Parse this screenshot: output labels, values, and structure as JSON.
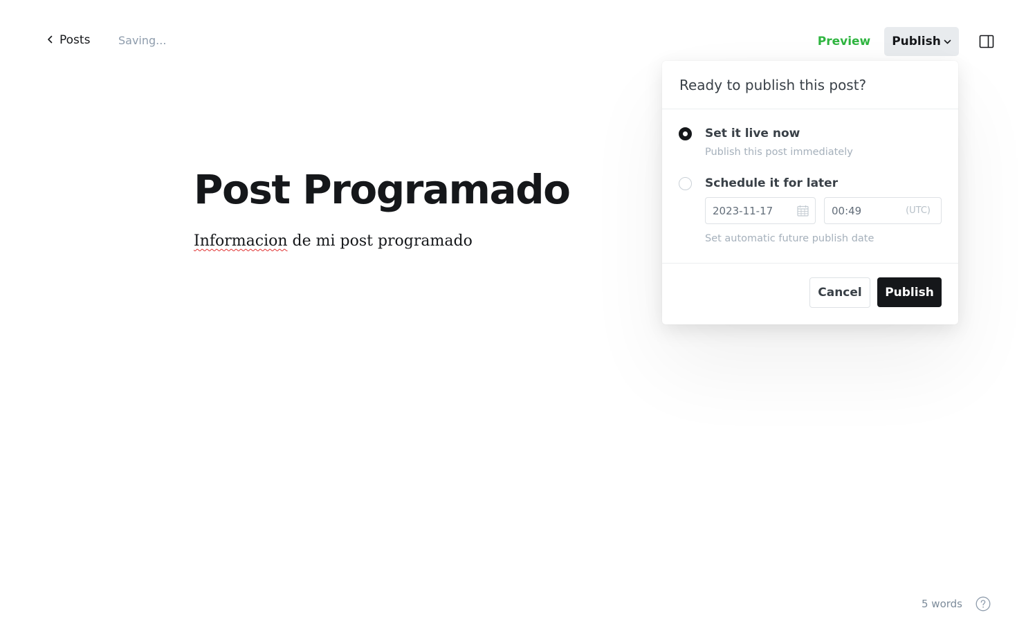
{
  "header": {
    "back_label": "Posts",
    "status": "Saving...",
    "preview_label": "Preview",
    "publish_label": "Publish",
    "icons": {
      "back": "chevron-left-icon",
      "publish_menu": "chevron-down-icon",
      "sidebar": "sidebar-panel-icon"
    }
  },
  "editor": {
    "title": "Post Programado",
    "body_misspelled": "Informacion",
    "body_rest": " de mi post programado"
  },
  "publish_popover": {
    "heading": "Ready to publish this post?",
    "options": [
      {
        "label": "Set it live now",
        "description": "Publish this post immediately",
        "selected": true
      },
      {
        "label": "Schedule it for later",
        "description": "Set automatic future publish date",
        "selected": false
      }
    ],
    "schedule": {
      "date": "2023-11-17",
      "time": "00:49",
      "timezone": "(UTC)",
      "date_icon": "calendar-icon"
    },
    "cancel_label": "Cancel",
    "publish_label": "Publish"
  },
  "footer": {
    "word_count": "5 words",
    "help_icon": "help-circle-icon"
  },
  "colors": {
    "preview_accent": "#2fb540",
    "primary_dark": "#15171a",
    "muted_text": "#a5b0bb"
  }
}
